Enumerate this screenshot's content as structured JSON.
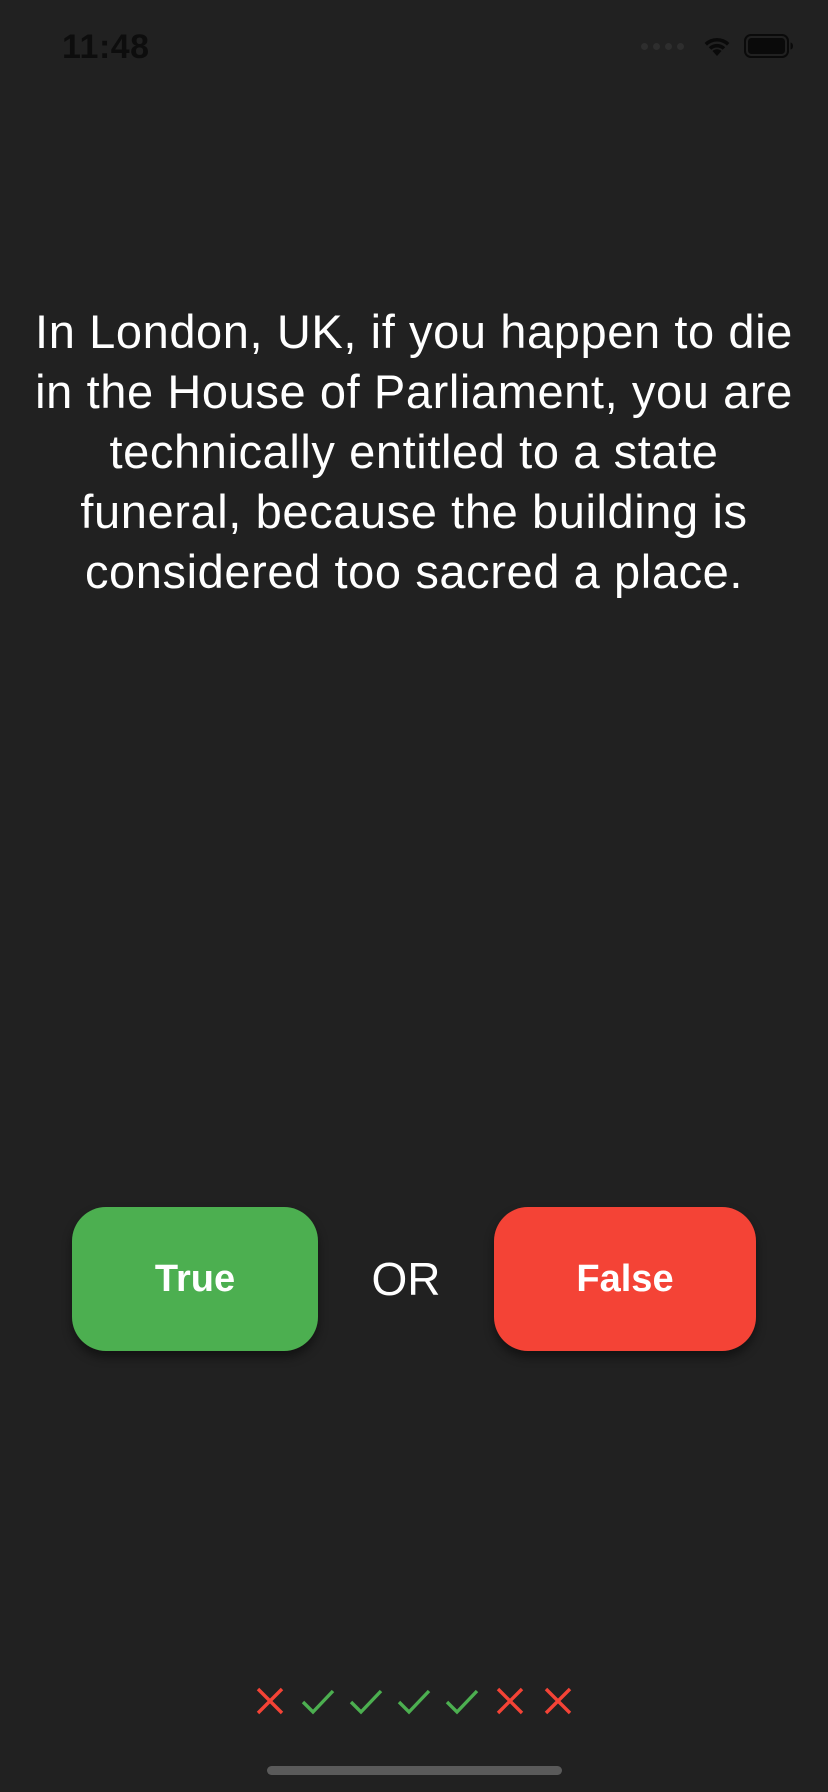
{
  "status_bar": {
    "time": "11:48",
    "signal_icon": "cellular-signal-icon",
    "wifi_icon": "wifi-icon",
    "battery_icon": "battery-icon"
  },
  "question": {
    "text": "In London, UK, if you happen to die in the House of Parliament, you are technically entitled to a state funeral, because the building is considered too sacred a place."
  },
  "answers": {
    "true_label": "True",
    "or_label": "OR",
    "false_label": "False"
  },
  "colors": {
    "background": "#212121",
    "true": "#4caf50",
    "false": "#f44336"
  },
  "score_keeper": [
    "wrong",
    "right",
    "right",
    "right",
    "right",
    "wrong",
    "wrong"
  ]
}
